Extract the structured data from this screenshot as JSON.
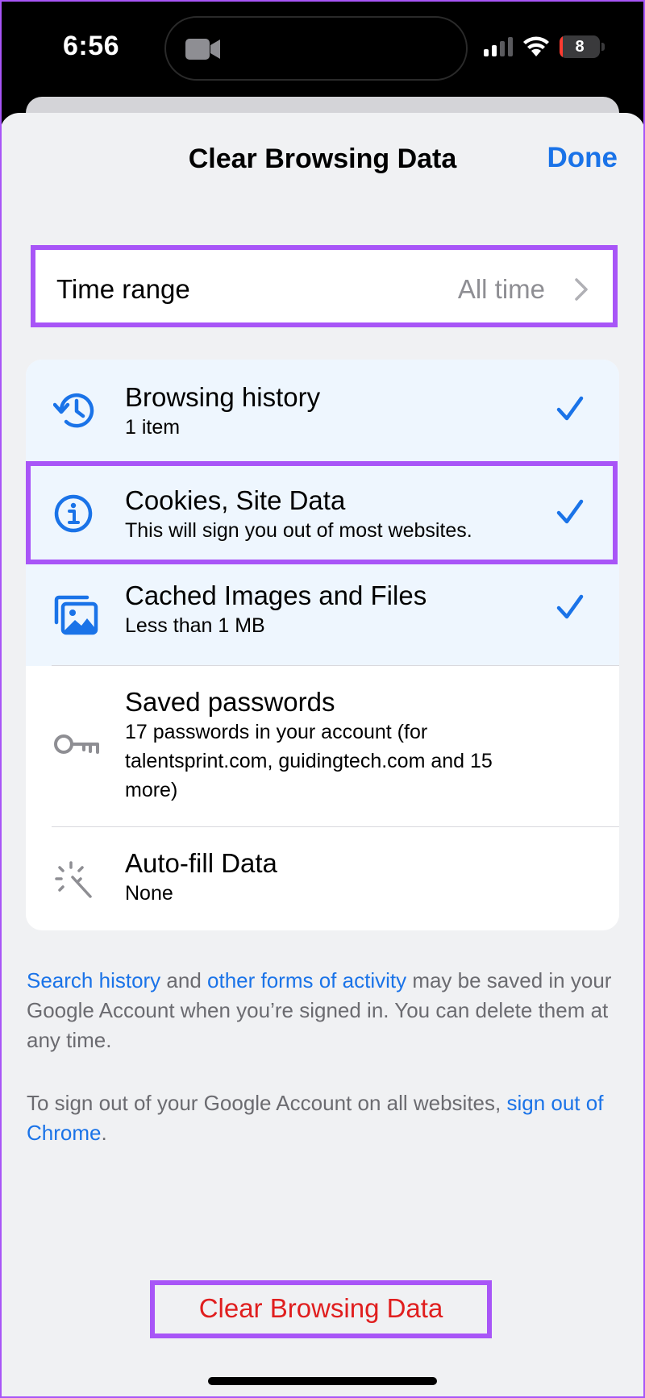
{
  "status_bar": {
    "time": "6:56",
    "battery_level": "8",
    "battery_fill_fraction": 0.08
  },
  "header": {
    "title": "Clear Browsing Data",
    "done_label": "Done"
  },
  "time_range": {
    "label": "Time range",
    "value": "All time"
  },
  "items": [
    {
      "title": "Browsing history",
      "subtitle": "1 item",
      "checked": true,
      "icon": "history-icon"
    },
    {
      "title": "Cookies, Site Data",
      "subtitle": "This will sign you out of most websites.",
      "checked": true,
      "icon": "info-icon"
    },
    {
      "title": "Cached Images and Files",
      "subtitle": "Less than 1 MB",
      "checked": true,
      "icon": "images-icon"
    },
    {
      "title": "Saved passwords",
      "subtitle": "17 passwords in your account (for talentsprint.com, guidingtech.com and 15 more)",
      "checked": false,
      "icon": "key-icon"
    },
    {
      "title": "Auto-fill Data",
      "subtitle": "None",
      "checked": false,
      "icon": "magic-wand-icon"
    }
  ],
  "footer": {
    "p1_link1": "Search history",
    "p1_text1": " and ",
    "p1_link2": "other forms of activity",
    "p1_text2": " may be saved in your Google Account when you’re signed in. You can delete them at any time.",
    "p2_text1": "To sign out of your Google Account on all websites, ",
    "p2_link": "sign out of Chrome",
    "p2_text2": "."
  },
  "clear_button_label": "Clear Browsing Data",
  "colors": {
    "accent_blue": "#1a73e8",
    "destructive_red": "#e01e1e",
    "highlight_purple": "#a855f7",
    "selected_row_bg": "#eef6fe"
  }
}
